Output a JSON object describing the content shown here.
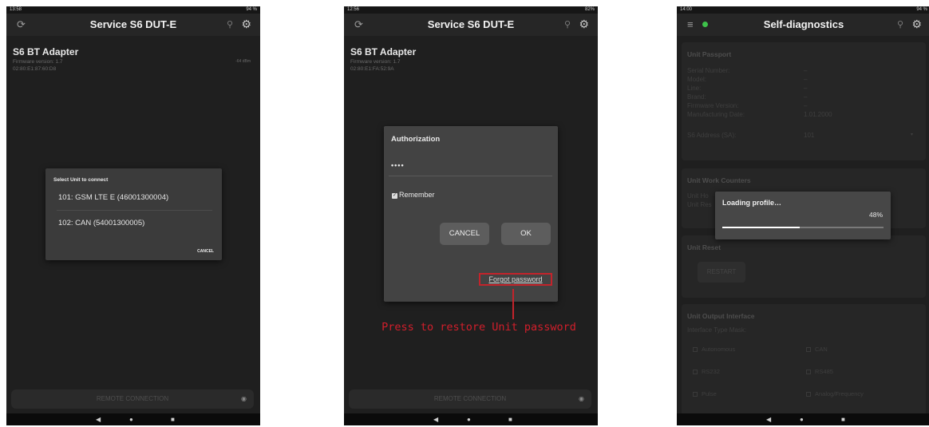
{
  "screen1": {
    "status_time": "13:58",
    "status_right": "94 %",
    "title": "Service S6 DUT-E",
    "device": {
      "name": "S6 BT Adapter",
      "firmware": "Firmware version: 1.7",
      "mac": "02:80:E1:87:60:D8",
      "signal": "-64 dBm"
    },
    "dialog": {
      "title": "Select Unit to connect",
      "options": [
        "101: GSM LTE E (46001300004)",
        "102: CAN (54001300005)"
      ],
      "cancel": "CANCEL"
    },
    "remote": "REMOTE CONNECTION"
  },
  "screen2": {
    "status_time": "12:56",
    "status_right": "82%",
    "title": "Service S6 DUT-E",
    "device": {
      "name": "S6 BT Adapter",
      "firmware": "Firmware version: 1.7",
      "mac": "02:80:E1:FA:52:9A"
    },
    "dialog": {
      "title": "Authorization",
      "password": "••••",
      "remember": "Remember",
      "cancel": "CANCEL",
      "ok": "OK",
      "forgot": "Forgot password"
    },
    "remote": "REMOTE CONNECTION",
    "hint": "Press to restore Unit password"
  },
  "screen3": {
    "status_time": "14:00",
    "status_right": "94 %",
    "title": "Self-diagnostics",
    "passport": {
      "title": "Unit Passport",
      "rows": [
        {
          "label": "Serial Number:",
          "value": "–"
        },
        {
          "label": "Model:",
          "value": "–"
        },
        {
          "label": "Line:",
          "value": "–"
        },
        {
          "label": "Brand:",
          "value": "–"
        },
        {
          "label": "Firmware Version:",
          "value": "–"
        },
        {
          "label": "Manufacturing Date:",
          "value": "1.01.2000"
        }
      ],
      "address_label": "S6 Address (SA):",
      "address_value": "101"
    },
    "counters": {
      "title": "Unit Work Counters",
      "rows": [
        "Unit Ho",
        "Unit Res"
      ]
    },
    "reset": {
      "title": "Unit Reset",
      "button": "RESTART"
    },
    "output": {
      "title": "Unit Output Interface",
      "mask_label": "Interface Type Mask:",
      "options": [
        "Autonomous",
        "CAN",
        "RS232",
        "RS485",
        "Pulse",
        "Analog/Frequency"
      ]
    },
    "loading": {
      "title": "Loading profile…",
      "percent_text": "48%",
      "progress": 0.48
    }
  }
}
